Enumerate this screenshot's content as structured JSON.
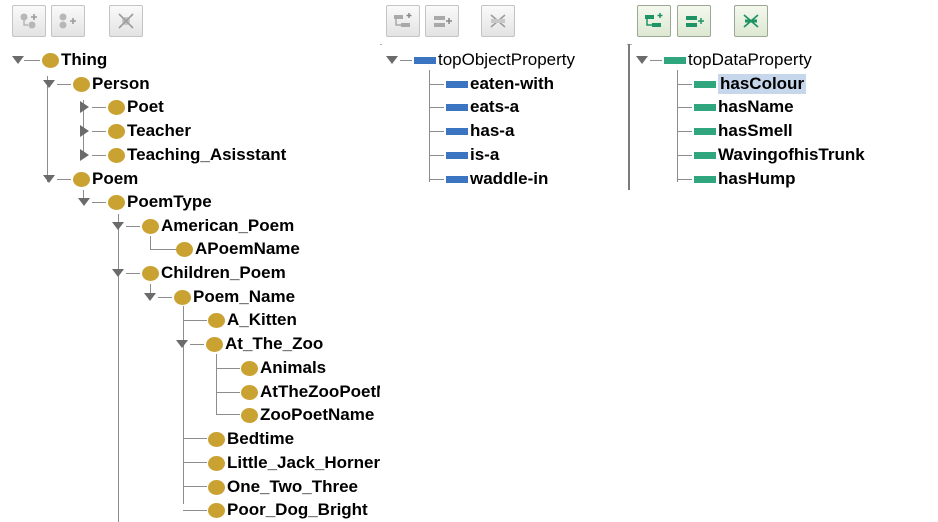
{
  "toolbars": {
    "classes": [
      "add-subclass-icon",
      "add-sibling-class-icon",
      "delete-class-icon"
    ],
    "object_properties": [
      "add-sub-property-icon",
      "add-sibling-property-icon",
      "delete-property-icon"
    ],
    "data_properties": [
      "add-sub-property-icon",
      "add-sibling-property-icon",
      "delete-property-icon"
    ]
  },
  "colors": {
    "class_dot": "#c9a232",
    "object_property": "#3b74c0",
    "data_property": "#2fa67d",
    "selection": "#c6d7ec"
  },
  "class_tree": {
    "root": "Thing",
    "person": "Person",
    "poet": "Poet",
    "teacher": "Teacher",
    "teaching_assistant": "Teaching_Asisstant",
    "poem": "Poem",
    "poem_type": "PoemType",
    "american_poem": "American_Poem",
    "a_poem_name": "APoemName",
    "children_poem": "Children_Poem",
    "poem_name": "Poem_Name",
    "a_kitten": "A_Kitten",
    "at_the_zoo": "At_The_Zoo",
    "animals": "Animals",
    "at_the_zoo_poet_name": "AtTheZooPoetName",
    "zoo_poet_name": "ZooPoetName",
    "bedtime": "Bedtime",
    "little_jack_horner": "Little_Jack_Horner",
    "one_two_three": "One_Two_Three",
    "poor_dog_bright": "Poor_Dog_Bright"
  },
  "object_properties": {
    "root": "topObjectProperty",
    "items": [
      "eaten-with",
      "eats-a",
      "has-a",
      "is-a",
      "waddle-in"
    ]
  },
  "data_properties": {
    "root": "topDataProperty",
    "items": [
      "hasColour",
      "hasName",
      "hasSmell",
      "WavingofhisTrunk",
      "hasHump"
    ],
    "selected": "hasColour"
  }
}
